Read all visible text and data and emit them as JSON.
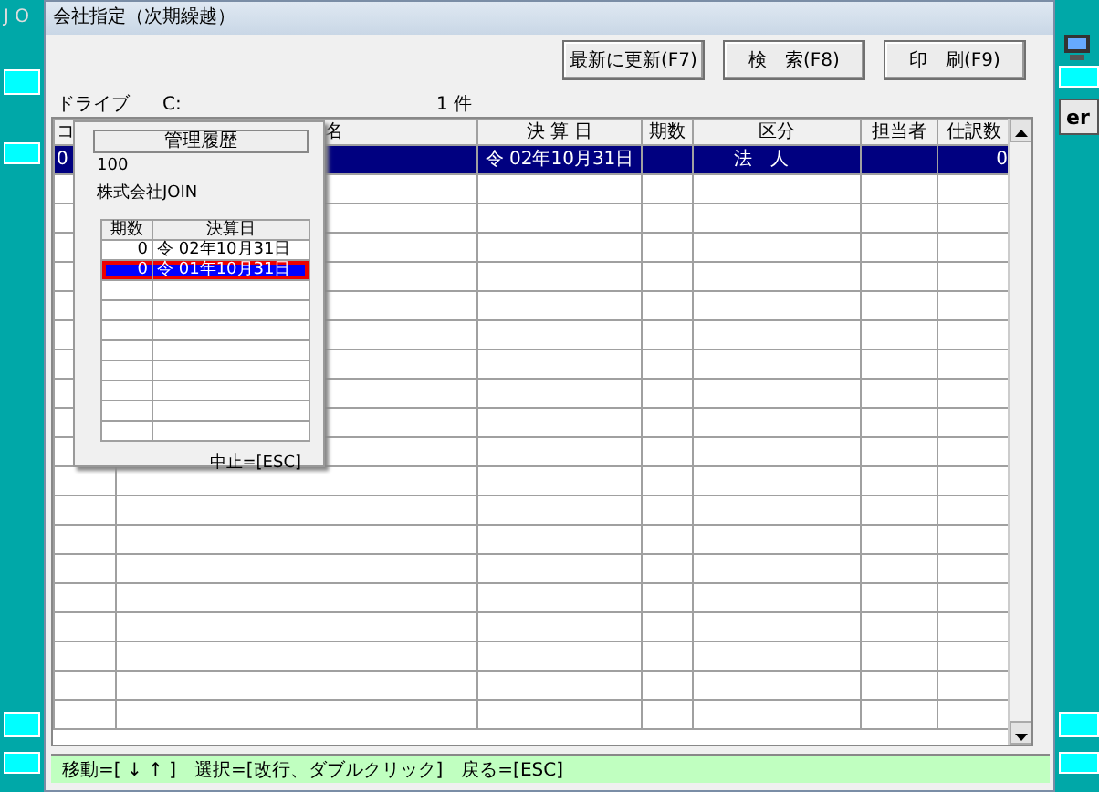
{
  "background": {
    "title": "J O",
    "button": "er"
  },
  "window": {
    "title": "会社指定（次期繰越）"
  },
  "buttons": [
    {
      "label": "最新に更新(F7)"
    },
    {
      "label": "検　索(F8)"
    },
    {
      "label": "印　刷(F9)"
    }
  ],
  "drive": {
    "label": "ドライブ",
    "value": "C:",
    "count": "1 件"
  },
  "table": {
    "columns": [
      "コ",
      "名",
      "決 算 日",
      "期数",
      "区分",
      "担当者",
      "仕訳数"
    ],
    "rows": [
      {
        "selected": true,
        "cells": {
          "1": "0",
          "3": "令 02年10月31日",
          "5": "法　人",
          "7": "0"
        }
      }
    ]
  },
  "history": {
    "title": "管理履歴",
    "code": "100",
    "company": "株式会社JOIN",
    "columns": [
      "期数",
      "決算日"
    ],
    "rows": [
      {
        "selected": false,
        "highlighted": false,
        "cells": [
          "0",
          "令 02年10月31日"
        ]
      },
      {
        "selected": true,
        "highlighted": true,
        "cells": [
          "0",
          "令 01年10月31日"
        ]
      }
    ],
    "hint": "中止=[ESC]"
  },
  "status_bar": "移動=[ ↓ ↑ ]　選択=[改行、ダブルクリック]　戻る=[ESC]"
}
